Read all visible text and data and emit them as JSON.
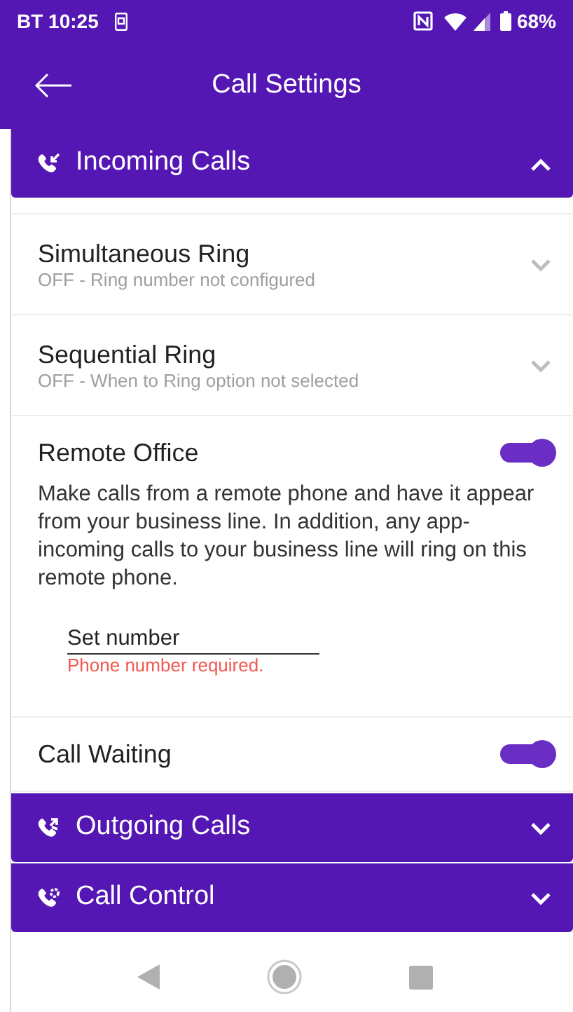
{
  "status_bar": {
    "carrier": "BT",
    "time": "10:25",
    "battery": "68%"
  },
  "header": {
    "title": "Call Settings"
  },
  "sections": [
    {
      "kind": "incoming",
      "title": "Incoming Calls",
      "expanded": true,
      "items": [
        {
          "kind": "expandable",
          "title": "Simultaneous Ring",
          "subtitle": "OFF - Ring number not configured",
          "expanded": false
        },
        {
          "kind": "expandable",
          "title": "Sequential Ring",
          "subtitle": "OFF - When to Ring option not selected",
          "expanded": false
        },
        {
          "kind": "toggle",
          "title": "Remote Office",
          "on": true,
          "description": "Make calls from a remote phone and have it appear from your business line. In addition, any app-incoming calls to your business line will ring on this remote phone.",
          "field": {
            "placeholder": "Set number",
            "error": "Phone number required."
          }
        },
        {
          "kind": "toggle",
          "title": "Call Waiting",
          "on": true
        }
      ]
    },
    {
      "kind": "outgoing",
      "title": "Outgoing Calls",
      "expanded": false
    },
    {
      "kind": "control",
      "title": "Call Control",
      "expanded": false
    }
  ]
}
